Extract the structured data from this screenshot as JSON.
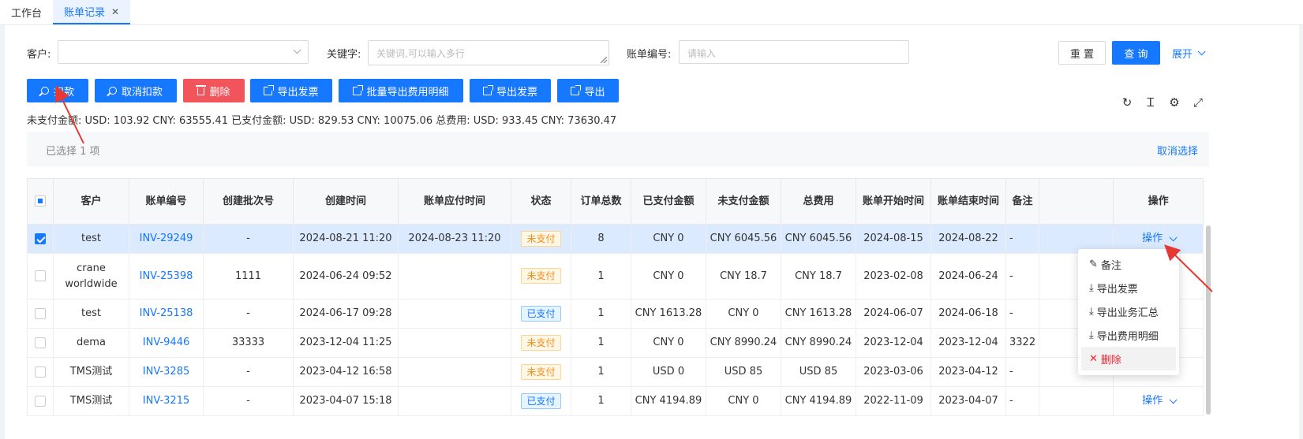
{
  "tabs": [
    {
      "label": "工作台"
    },
    {
      "label": "账单记录",
      "close": "✕"
    }
  ],
  "filters": {
    "customer_label": "客户:",
    "keyword_label": "关键字:",
    "keyword_placeholder": "关键词,可以输入多行",
    "bill_no_label": "账单编号:",
    "bill_no_placeholder": "请输入",
    "reset": "重 置",
    "query": "查 询",
    "expand": "展开"
  },
  "actions": {
    "deduct": "扣款",
    "cancel_deduct": "取消扣款",
    "delete": "删除",
    "export_invoice": "导出发票",
    "batch_export": "批量导出费用明细",
    "export_invoice2": "导出发票",
    "export": "导出"
  },
  "summary": "未支付金额: USD: 103.92 CNY: 63555.41  已支付金额: USD: 829.53 CNY: 10075.06  总费用: USD: 933.45 CNY: 73630.47",
  "selection": {
    "text": "已选择  1  项",
    "clear": "取消选择"
  },
  "table": {
    "headers": [
      "客户",
      "账单编号",
      "创建批次号",
      "创建时间",
      "账单应付时间",
      "状态",
      "订单总数",
      "已支付金额",
      "未支付金额",
      "总费用",
      "账单开始时间",
      "账单结束时间",
      "备注",
      "",
      "操作"
    ],
    "rows": [
      {
        "customer": "test",
        "bill": "INV-29249",
        "batch": "-",
        "created": "2024-08-21 11:20",
        "due": "2024-08-23 11:20",
        "status": "未支付",
        "orders": "8",
        "paid": "CNY 0",
        "unpaid": "CNY 6045.56",
        "total": "CNY 6045.56",
        "start": "2024-08-15",
        "end": "2024-08-22",
        "note": "-",
        "op": "操作"
      },
      {
        "customer": "crane worldwide",
        "bill": "INV-25398",
        "batch": "1111",
        "created": "2024-06-24 09:52",
        "due": "",
        "status": "未支付",
        "orders": "1",
        "paid": "CNY 0",
        "unpaid": "CNY 18.7",
        "total": "CNY 18.7",
        "start": "2023-02-08",
        "end": "2024-06-24",
        "note": "-",
        "op": ""
      },
      {
        "customer": "test",
        "bill": "INV-25138",
        "batch": "-",
        "created": "2024-06-17 09:28",
        "due": "",
        "status": "已支付",
        "orders": "1",
        "paid": "CNY 1613.28",
        "unpaid": "CNY 0",
        "total": "CNY 1613.28",
        "start": "2024-06-07",
        "end": "2024-06-18",
        "note": "-",
        "op": ""
      },
      {
        "customer": "dema",
        "bill": "INV-9446",
        "batch": "33333",
        "created": "2023-12-04 11:25",
        "due": "",
        "status": "未支付",
        "orders": "1",
        "paid": "CNY 0",
        "unpaid": "CNY 8990.24",
        "total": "CNY 8990.24",
        "start": "2023-12-04",
        "end": "2023-12-04",
        "note": "3322",
        "op": ""
      },
      {
        "customer": "TMS测试",
        "bill": "INV-3285",
        "batch": "-",
        "created": "2023-04-12 16:58",
        "due": "",
        "status": "未支付",
        "orders": "1",
        "paid": "USD 0",
        "unpaid": "USD 85",
        "total": "USD 85",
        "start": "2023-03-06",
        "end": "2023-04-12",
        "note": "-",
        "op": ""
      },
      {
        "customer": "TMS测试",
        "bill": "INV-3215",
        "batch": "-",
        "created": "2023-04-07 15:18",
        "due": "",
        "status": "已支付",
        "orders": "1",
        "paid": "CNY 4194.89",
        "unpaid": "CNY 0",
        "total": "CNY 4194.89",
        "start": "2022-11-09",
        "end": "2023-04-07",
        "note": "-",
        "op": "操作"
      }
    ]
  },
  "dropdown": {
    "items": [
      "备注",
      "导出发票",
      "导出业务汇总",
      "导出费用明细",
      "删除"
    ]
  },
  "colors": {
    "primary": "#1677ff",
    "danger": "#f2545b",
    "annotation": "#e53935"
  }
}
